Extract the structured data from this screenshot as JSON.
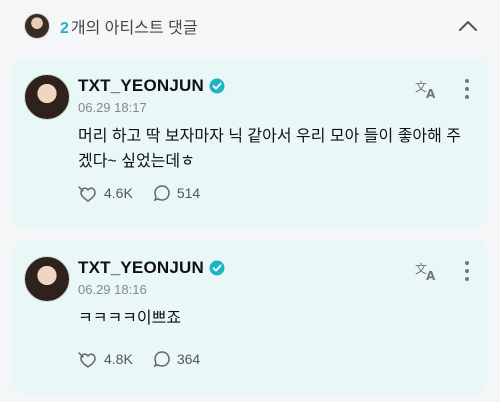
{
  "header": {
    "count": "2",
    "label": "개의 아티스트 댓글"
  },
  "comments": [
    {
      "author": "TXT_YEONJUN",
      "date": "06.29 18:17",
      "text": "머리 하고 딱 보자마자 닉 같아서 우리 모아 들이 좋아해 주겠다~ 싶었는데ㅎ",
      "likes": "4.6K",
      "replies": "514"
    },
    {
      "author": "TXT_YEONJUN",
      "date": "06.29 18:16",
      "text": "ㅋㅋㅋㅋ이쁘죠",
      "likes": "4.8K",
      "replies": "364"
    }
  ],
  "colors": {
    "accent": "#20b2c6",
    "card_bg": "#e9f8f7",
    "page_bg": "#f4f6f8"
  },
  "icons": [
    "chevron-up-icon",
    "verified-badge-icon",
    "translate-icon",
    "more-vertical-icon",
    "like-icon",
    "reply-icon"
  ]
}
